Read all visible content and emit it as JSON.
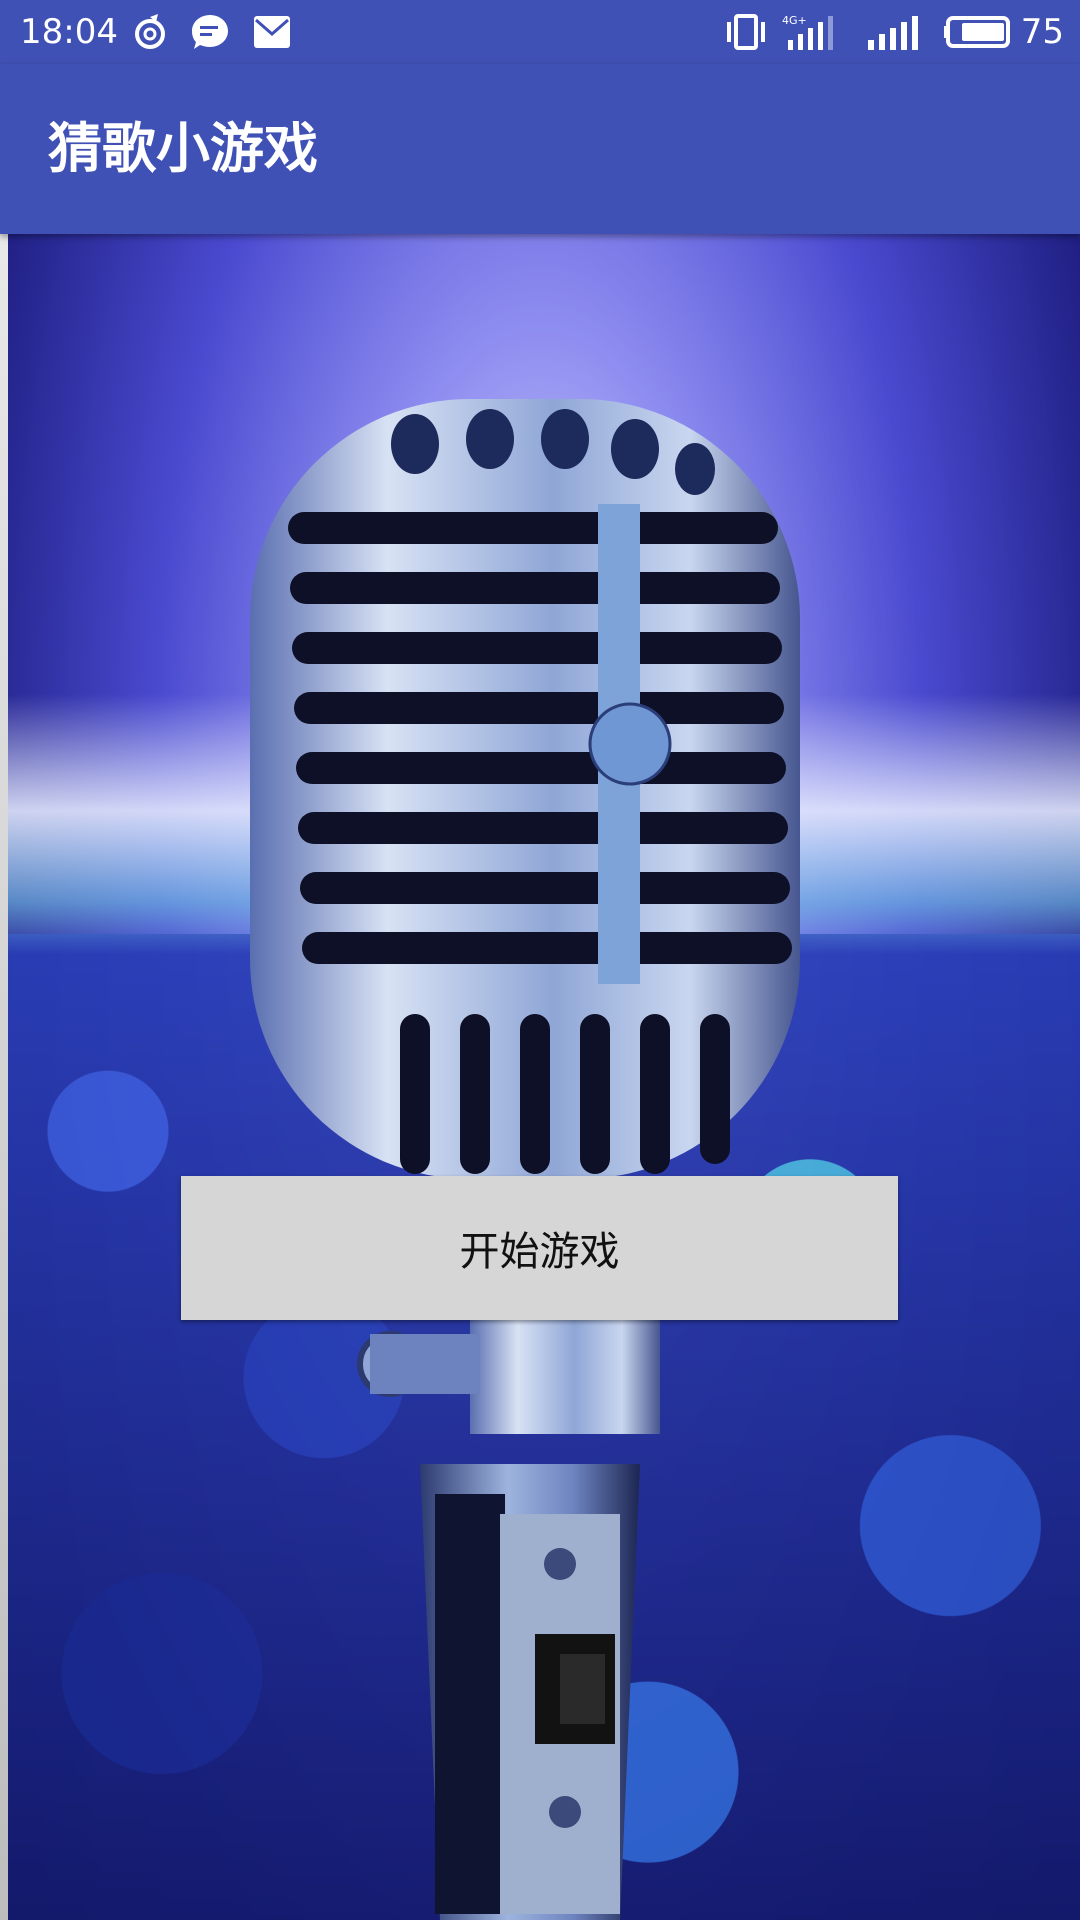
{
  "status_bar": {
    "time": "18:04",
    "battery_level": "75",
    "icons": [
      "sync-icon",
      "message-icon",
      "mail-icon",
      "vibrate-icon",
      "network-4g-icon",
      "signal-icon",
      "battery-icon"
    ],
    "network_label": "4G+"
  },
  "app_bar": {
    "title": "猜歌小游戏"
  },
  "main": {
    "background_image": "microphone-concert-image",
    "start_button_label": "开始游戏"
  },
  "colors": {
    "primary": "#3F51B5",
    "button_bg": "#D6D6D6",
    "button_text": "#111111"
  }
}
